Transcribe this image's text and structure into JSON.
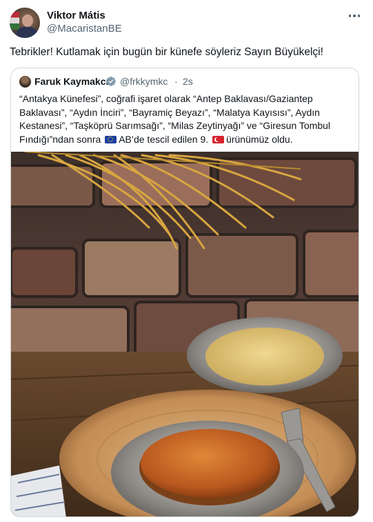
{
  "tweet": {
    "author_name": "Viktor Mátis",
    "author_handle": "@MacaristanBE",
    "text": "Tebrikler! Kutlamak için bugün bir künefe söyleriz Sayın Büyükelçi!",
    "more_icon": "more-horizontal-icon",
    "avatar_icon": "profile-photo"
  },
  "quote": {
    "author_name": "Faruk Kaymakcı",
    "verified_icon": "verified-badge-icon",
    "author_handle": "@frkkymkc",
    "separator": "·",
    "time": "2s",
    "text_lines": [
      "“Antakya Künefesi”, coğrafi işaret olarak “Antep Baklavası/Gaziantep",
      "Baklavası”, “Aydın İnciri”, “Bayramiç Beyazı”, “Malatya Kayısısı”, Aydın",
      "Kestanesi”, “Taşköprü Sarımsağı”, “Milas Zeytinyağı” ve “Giresun Tombul"
    ],
    "last_line": {
      "part1": "Fındığı”ndan sonra",
      "flag_eu": "eu-flag-emoji",
      "part2": "AB’de tescil edilen 9.",
      "flag_tr": "turkey-flag-emoji",
      "part3": "ürünümüz oldu."
    },
    "image": "kunefe-photo"
  },
  "colors": {
    "text_primary": "#0f1419",
    "text_secondary": "#536471",
    "border": "#cfd9de",
    "verified": "#829aab"
  }
}
